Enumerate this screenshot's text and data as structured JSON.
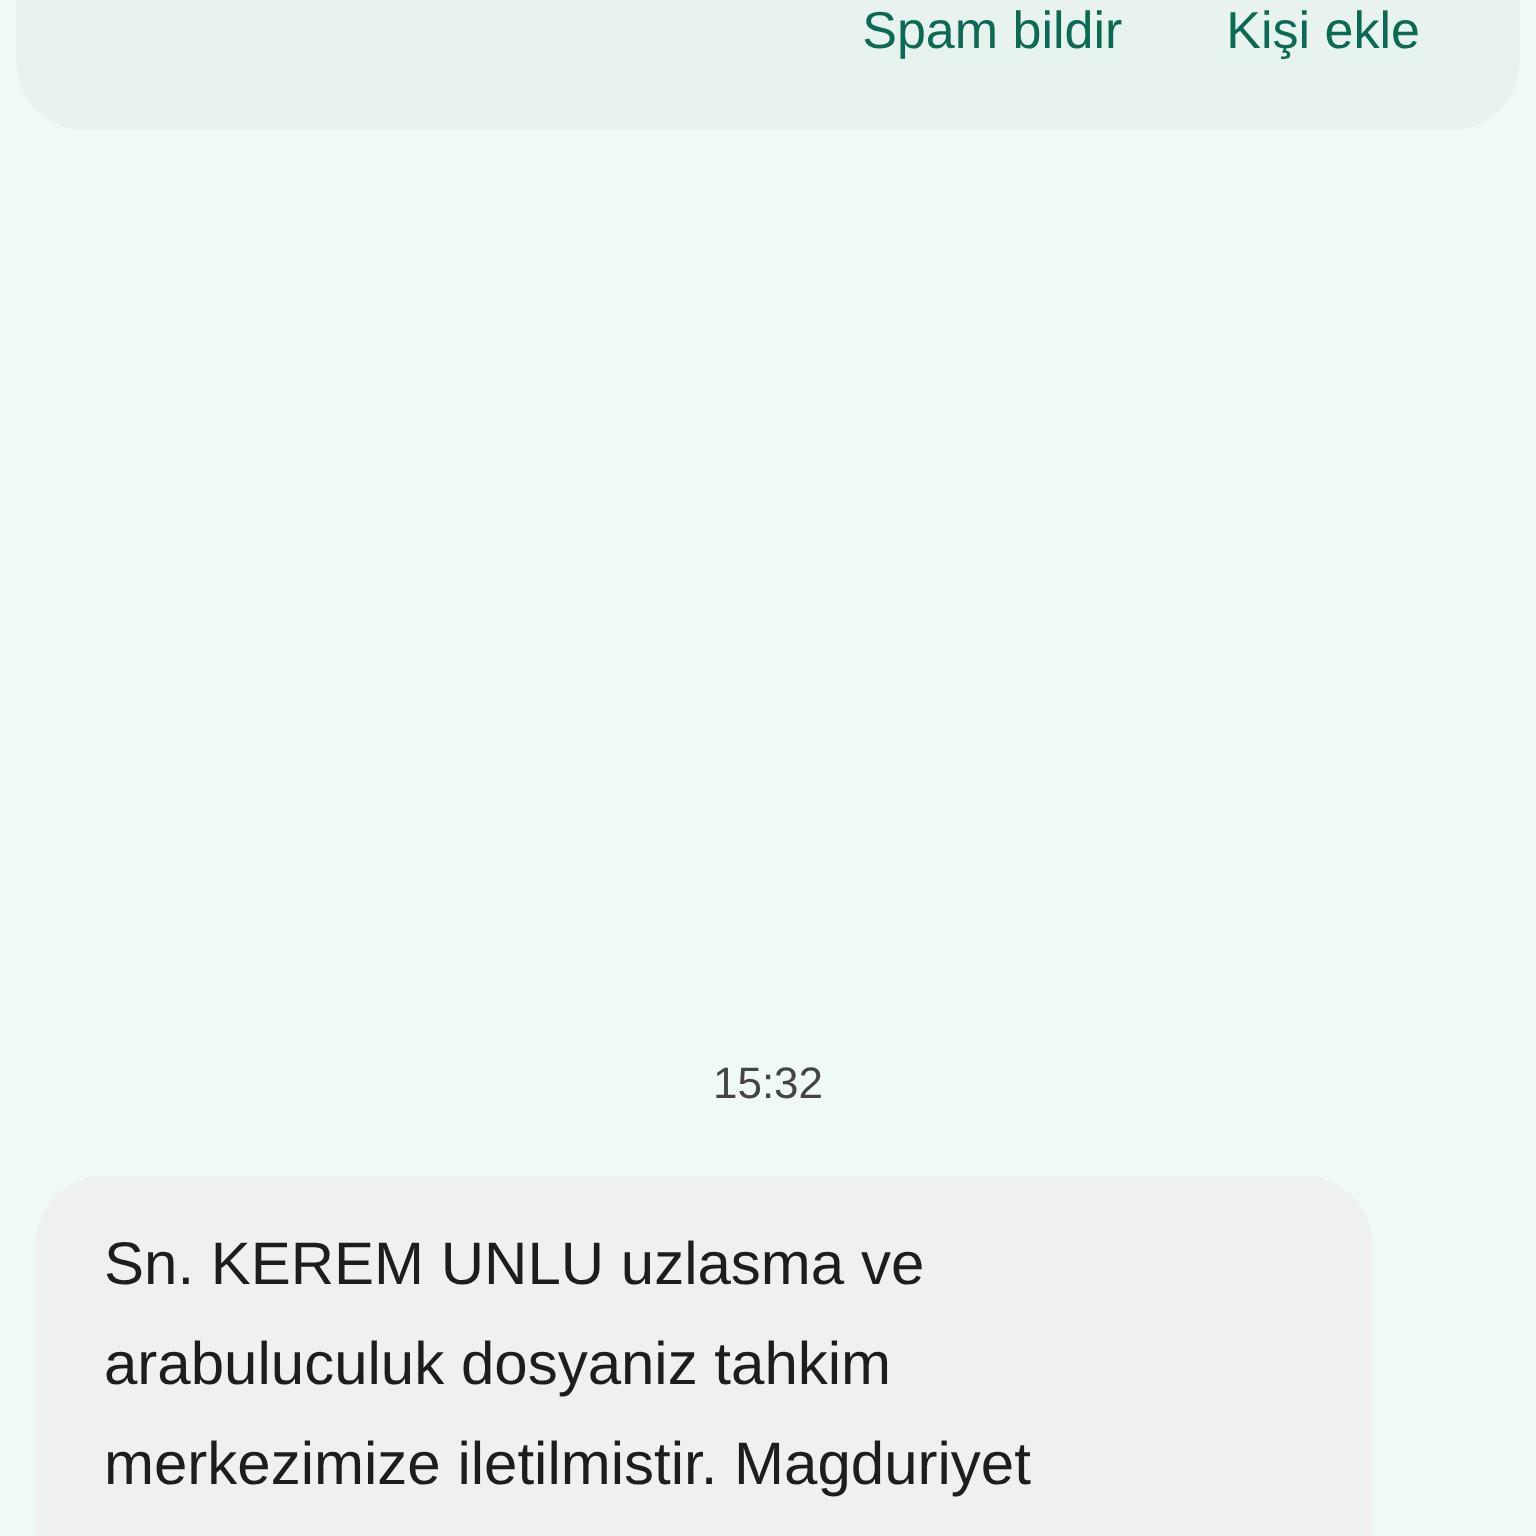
{
  "actions": [
    {
      "label": "Spam bildir"
    },
    {
      "label": "Kişi ekle"
    }
  ],
  "timestamp": "15:32",
  "message": {
    "lines": [
      "Sn. KEREM UNLU uzlasma ve",
      "arabuluculuk dosyaniz tahkim",
      "merkezimize iletilmistir. Magduriyet"
    ]
  }
}
